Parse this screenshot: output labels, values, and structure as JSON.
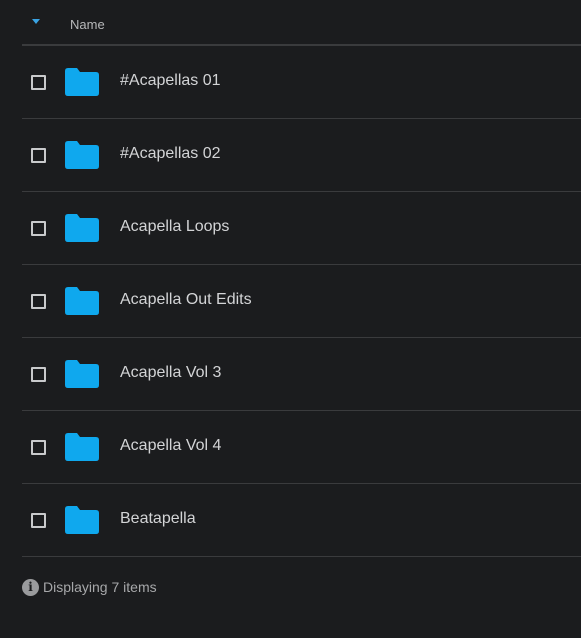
{
  "header": {
    "column_name": "Name"
  },
  "items": [
    {
      "label": "#Acapellas 01",
      "icon": "folder-icon"
    },
    {
      "label": "#Acapellas 02",
      "icon": "folder-icon"
    },
    {
      "label": "Acapella Loops",
      "icon": "folder-icon"
    },
    {
      "label": "Acapella Out Edits",
      "icon": "folder-icon"
    },
    {
      "label": "Acapella Vol 3",
      "icon": "folder-icon"
    },
    {
      "label": "Acapella Vol 4",
      "icon": "folder-icon"
    },
    {
      "label": "Beatapella",
      "icon": "folder-icon"
    }
  ],
  "footer": {
    "status": "Displaying 7 items",
    "icon": "info-icon"
  },
  "colors": {
    "background": "#1b1c1e",
    "folder": "#0fa8ee",
    "accent": "#3aa3e3",
    "divider": "#3a3b3d"
  }
}
